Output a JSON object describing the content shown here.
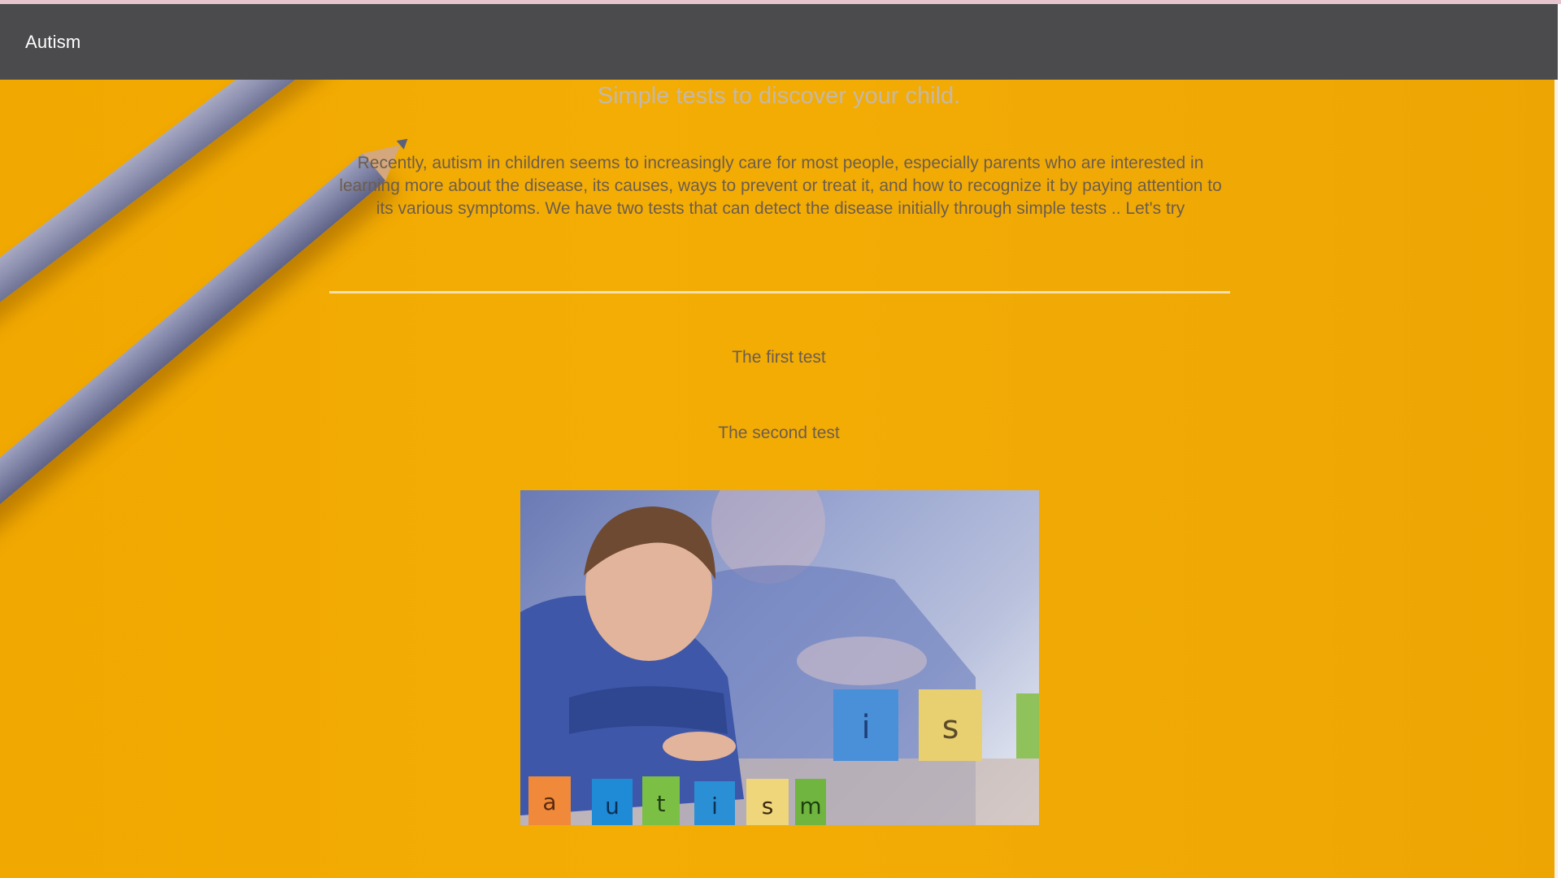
{
  "navbar": {
    "brand": "Autism"
  },
  "main": {
    "subtitle": "Simple tests to discover your child.",
    "intro": "Recently, autism in children seems to increasingly care for most people, especially parents who are interested in learning more about the disease, its causes, ways to prevent or treat it, and how to recognize it by paying attention to its various symptoms. We have two tests that can detect the disease initially through simple tests .. Let's try",
    "tests": [
      {
        "label": "The first test"
      },
      {
        "label": "The second test"
      }
    ],
    "photo": {
      "blocks_front": [
        "a",
        "u",
        "t",
        "i",
        "s",
        "m"
      ],
      "blocks_back": [
        "i",
        "s"
      ]
    }
  },
  "colors": {
    "background": "#f1a800",
    "navbar": "#4b4a4c",
    "text": "#6d5d4d",
    "subtitle": "#c5b8a8"
  }
}
